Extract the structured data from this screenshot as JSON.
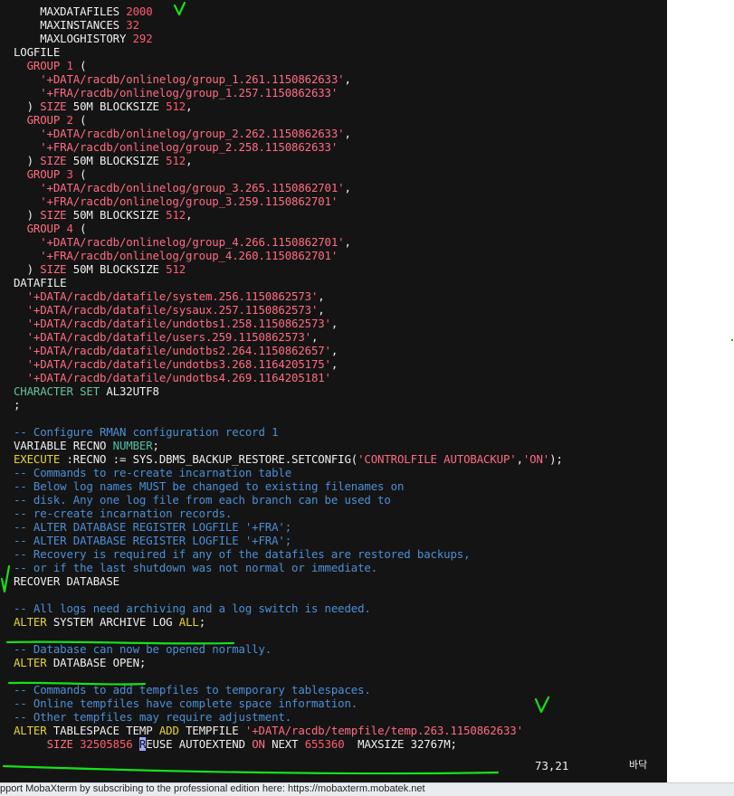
{
  "terminal": {
    "lines": [
      [
        {
          "t": "    MAXDATAFILES ",
          "c": ""
        },
        {
          "t": "2000",
          "c": "num"
        }
      ],
      [
        {
          "t": "    MAXINSTANCES ",
          "c": ""
        },
        {
          "t": "32",
          "c": "num"
        }
      ],
      [
        {
          "t": "    MAXLOGHISTORY ",
          "c": ""
        },
        {
          "t": "292",
          "c": "num"
        }
      ],
      [
        {
          "t": "LOGFILE",
          "c": ""
        }
      ],
      [
        {
          "t": "  GROUP ",
          "c": "str"
        },
        {
          "t": "1",
          "c": "num"
        },
        {
          "t": " (",
          "c": ""
        }
      ],
      [
        {
          "t": "    '+DATA/racdb/onlinelog/group_1.261.1150862633'",
          "c": "str"
        },
        {
          "t": ",",
          "c": ""
        }
      ],
      [
        {
          "t": "    '+FRA/racdb/onlinelog/group_1.257.1150862633'",
          "c": "str"
        }
      ],
      [
        {
          "t": "  ) ",
          "c": ""
        },
        {
          "t": "SIZE",
          "c": "str"
        },
        {
          "t": " 50M BLOCKSIZE ",
          "c": ""
        },
        {
          "t": "512",
          "c": "num"
        },
        {
          "t": ",",
          "c": ""
        }
      ],
      [
        {
          "t": "  GROUP ",
          "c": "str"
        },
        {
          "t": "2",
          "c": "num"
        },
        {
          "t": " (",
          "c": ""
        }
      ],
      [
        {
          "t": "    '+DATA/racdb/onlinelog/group_2.262.1150862633'",
          "c": "str"
        },
        {
          "t": ",",
          "c": ""
        }
      ],
      [
        {
          "t": "    '+FRA/racdb/onlinelog/group_2.258.1150862633'",
          "c": "str"
        }
      ],
      [
        {
          "t": "  ) ",
          "c": ""
        },
        {
          "t": "SIZE",
          "c": "str"
        },
        {
          "t": " 50M BLOCKSIZE ",
          "c": ""
        },
        {
          "t": "512",
          "c": "num"
        },
        {
          "t": ",",
          "c": ""
        }
      ],
      [
        {
          "t": "  GROUP ",
          "c": "str"
        },
        {
          "t": "3",
          "c": "num"
        },
        {
          "t": " (",
          "c": ""
        }
      ],
      [
        {
          "t": "    '+DATA/racdb/onlinelog/group_3.265.1150862701'",
          "c": "str"
        },
        {
          "t": ",",
          "c": ""
        }
      ],
      [
        {
          "t": "    '+FRA/racdb/onlinelog/group_3.259.1150862701'",
          "c": "str"
        }
      ],
      [
        {
          "t": "  ) ",
          "c": ""
        },
        {
          "t": "SIZE",
          "c": "str"
        },
        {
          "t": " 50M BLOCKSIZE ",
          "c": ""
        },
        {
          "t": "512",
          "c": "num"
        },
        {
          "t": ",",
          "c": ""
        }
      ],
      [
        {
          "t": "  GROUP ",
          "c": "str"
        },
        {
          "t": "4",
          "c": "num"
        },
        {
          "t": " (",
          "c": ""
        }
      ],
      [
        {
          "t": "    '+DATA/racdb/onlinelog/group_4.266.1150862701'",
          "c": "str"
        },
        {
          "t": ",",
          "c": ""
        }
      ],
      [
        {
          "t": "    '+FRA/racdb/onlinelog/group_4.260.1150862701'",
          "c": "str"
        }
      ],
      [
        {
          "t": "  ) ",
          "c": ""
        },
        {
          "t": "SIZE",
          "c": "str"
        },
        {
          "t": " 50M BLOCKSIZE ",
          "c": ""
        },
        {
          "t": "512",
          "c": "num"
        }
      ],
      [
        {
          "t": "DATAFILE",
          "c": ""
        }
      ],
      [
        {
          "t": "  '+DATA/racdb/datafile/system.256.1150862573'",
          "c": "str"
        },
        {
          "t": ",",
          "c": ""
        }
      ],
      [
        {
          "t": "  '+DATA/racdb/datafile/sysaux.257.1150862573'",
          "c": "str"
        },
        {
          "t": ",",
          "c": ""
        }
      ],
      [
        {
          "t": "  '+DATA/racdb/datafile/undotbs1.258.1150862573'",
          "c": "str"
        },
        {
          "t": ",",
          "c": ""
        }
      ],
      [
        {
          "t": "  '+DATA/racdb/datafile/users.259.1150862573'",
          "c": "str"
        },
        {
          "t": ",",
          "c": ""
        }
      ],
      [
        {
          "t": "  '+DATA/racdb/datafile/undotbs2.264.1150862657'",
          "c": "str"
        },
        {
          "t": ",",
          "c": ""
        }
      ],
      [
        {
          "t": "  '+DATA/racdb/datafile/undotbs3.268.1164205175'",
          "c": "str"
        },
        {
          "t": ",",
          "c": ""
        }
      ],
      [
        {
          "t": "  '+DATA/racdb/datafile/undotbs4.269.1164205181'",
          "c": "str"
        }
      ],
      [
        {
          "t": "CHARACTER SET",
          "c": "grn"
        },
        {
          "t": " AL32UTF8",
          "c": ""
        }
      ],
      [
        {
          "t": ";",
          "c": ""
        }
      ],
      [
        {
          "t": "",
          "c": ""
        }
      ],
      [
        {
          "t": "-- Configure RMAN configuration record 1",
          "c": "cmt"
        }
      ],
      [
        {
          "t": "VARIABLE RECNO ",
          "c": ""
        },
        {
          "t": "NUMBER",
          "c": "typ"
        },
        {
          "t": ";",
          "c": ""
        }
      ],
      [
        {
          "t": "EXECUTE",
          "c": "kw"
        },
        {
          "t": " :RECNO := SYS.DBMS_BACKUP_RESTORE.SETCONFIG(",
          "c": ""
        },
        {
          "t": "'CONTROLFILE AUTOBACKUP'",
          "c": "str"
        },
        {
          "t": ",",
          "c": ""
        },
        {
          "t": "'ON'",
          "c": "str"
        },
        {
          "t": ");",
          "c": ""
        }
      ],
      [
        {
          "t": "-- Commands to re-create incarnation table",
          "c": "cmt"
        }
      ],
      [
        {
          "t": "-- Below log names MUST be changed to existing filenames on",
          "c": "cmt"
        }
      ],
      [
        {
          "t": "-- disk. Any one log file from each branch can be used to",
          "c": "cmt"
        }
      ],
      [
        {
          "t": "-- re-create incarnation records.",
          "c": "cmt"
        }
      ],
      [
        {
          "t": "-- ALTER DATABASE REGISTER LOGFILE '+FRA';",
          "c": "cmt"
        }
      ],
      [
        {
          "t": "-- ALTER DATABASE REGISTER LOGFILE '+FRA';",
          "c": "cmt"
        }
      ],
      [
        {
          "t": "-- Recovery is required if any of the datafiles are restored backups,",
          "c": "cmt"
        }
      ],
      [
        {
          "t": "-- or if the last shutdown was not normal or immediate.",
          "c": "cmt"
        }
      ],
      [
        {
          "t": "RECOVER DATABASE",
          "c": ""
        }
      ],
      [
        {
          "t": "",
          "c": ""
        }
      ],
      [
        {
          "t": "-- All logs need archiving and a log switch is needed.",
          "c": "cmt"
        }
      ],
      [
        {
          "t": "ALTER",
          "c": "kw"
        },
        {
          "t": " SYSTEM ARCHIVE LOG ",
          "c": ""
        },
        {
          "t": "ALL",
          "c": "kw"
        },
        {
          "t": ";",
          "c": ""
        }
      ],
      [
        {
          "t": "",
          "c": ""
        }
      ],
      [
        {
          "t": "-- Database can now be opened normally.",
          "c": "cmt"
        }
      ],
      [
        {
          "t": "ALTER",
          "c": "kw"
        },
        {
          "t": " DATABASE OPEN;",
          "c": ""
        }
      ],
      [
        {
          "t": "",
          "c": ""
        }
      ],
      [
        {
          "t": "-- Commands to add tempfiles to temporary tablespaces.",
          "c": "cmt"
        }
      ],
      [
        {
          "t": "-- Online tempfiles have complete space information.",
          "c": "cmt"
        }
      ],
      [
        {
          "t": "-- Other tempfiles may require adjustment.",
          "c": "cmt"
        }
      ],
      [
        {
          "t": "ALTER",
          "c": "kw"
        },
        {
          "t": " TABLESPACE TEMP ",
          "c": ""
        },
        {
          "t": "ADD",
          "c": "kw"
        },
        {
          "t": " TEMPFILE ",
          "c": ""
        },
        {
          "t": "'+DATA/racdb/tempfile/temp.263.1150862633'",
          "c": "str"
        }
      ],
      [
        {
          "t": "     ",
          "c": ""
        },
        {
          "t": "SIZE",
          "c": "str"
        },
        {
          "t": " ",
          "c": ""
        },
        {
          "t": "32505856",
          "c": "num"
        },
        {
          "t": " ",
          "c": ""
        },
        {
          "t": "R",
          "c": "cursor"
        },
        {
          "t": "EUSE AUTOEXTEND ",
          "c": ""
        },
        {
          "t": "ON",
          "c": "str"
        },
        {
          "t": " NEXT ",
          "c": ""
        },
        {
          "t": "655360",
          "c": "num"
        },
        {
          "t": "  MAXSIZE 32767M;",
          "c": ""
        }
      ]
    ],
    "status_position": "73,21",
    "status_end": "바닥"
  },
  "footer": {
    "text": "pport MobaXterm by subscribing to the professional edition here:",
    "link": "https://mobaxterm.mobatek.net"
  },
  "colors": {
    "terminal_bg": "#141414",
    "annotation_green": "#18e018",
    "comment_blue": "#4b8fd6",
    "keyword_yellow": "#e4d43a",
    "string_red": "#ff6b82"
  }
}
